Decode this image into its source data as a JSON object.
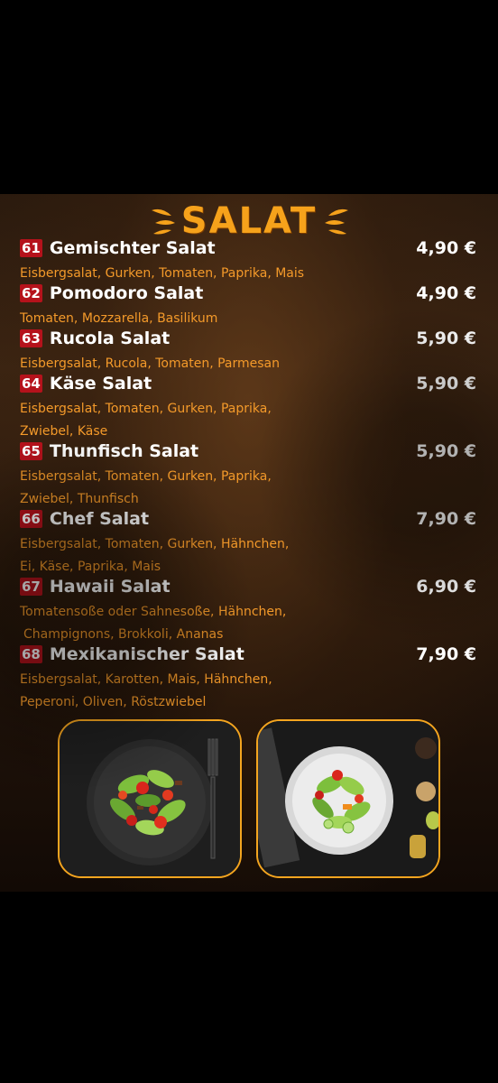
{
  "section_title": "SALAT",
  "items": [
    {
      "num": "61",
      "name": "Gemischter Salat",
      "price": "4,90 €",
      "desc_lines": [
        "Eisbergsalat, Gurken, Tomaten, Paprika, Mais"
      ]
    },
    {
      "num": "62",
      "name": "Pomodoro Salat",
      "price": "4,90 €",
      "desc_lines": [
        "Tomaten, Mozzarella, Basilikum"
      ]
    },
    {
      "num": "63",
      "name": "Rucola Salat",
      "price": "5,90 €",
      "desc_lines": [
        "Eisbergsalat, Rucola, Tomaten, Parmesan"
      ]
    },
    {
      "num": "64",
      "name": "Käse Salat",
      "price": "5,90 €",
      "desc_lines": [
        "Eisbergsalat, Tomaten, Gurken, Paprika,",
        "Zwiebel, Käse"
      ]
    },
    {
      "num": "65",
      "name": "Thunfisch Salat",
      "price": "5,90 €",
      "desc_lines": [
        "Eisbergsalat, Tomaten, Gurken, Paprika,",
        "Zwiebel, Thunfisch"
      ]
    },
    {
      "num": "66",
      "name": "Chef Salat",
      "price": "7,90 €",
      "desc_lines": [
        "Eisbergsalat, Tomaten, Gurken, Hähnchen,",
        "Ei, Käse, Paprika, Mais"
      ]
    },
    {
      "num": "67",
      "name": "Hawaii Salat",
      "price": "6,90 €",
      "desc_lines": [
        "Tomatensoße oder Sahnesoße, Hähnchen,",
        "Champignons, Brokkoli, Ananas"
      ]
    },
    {
      "num": "68",
      "name": "Mexikanischer Salat",
      "price": "7,90 €",
      "desc_lines": [
        "Eisbergsalat, Karotten, Mais, Hähnchen,",
        "Peperoni, Oliven, Röstzwiebel"
      ]
    }
  ],
  "colors": {
    "title": "#f6a21b",
    "description": "#f49a2a",
    "number_badge": "#b5121b",
    "photo_border": "#f4a51f"
  },
  "photos": [
    {
      "icon": "salad-plate-with-fork-photo"
    },
    {
      "icon": "salad-plate-with-dressing-photo"
    }
  ]
}
